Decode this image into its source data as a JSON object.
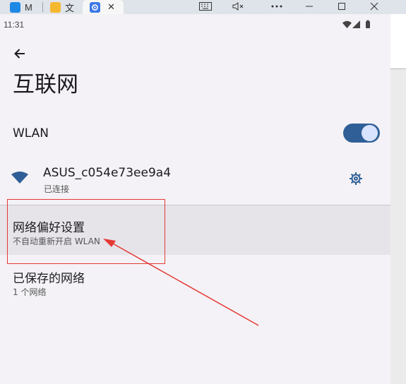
{
  "browser": {
    "tabs": [
      {
        "label": "M",
        "color": "#1e88e5"
      },
      {
        "label": "文",
        "color": "#f5b82e"
      },
      {
        "label": "",
        "color": "#3b78e7"
      }
    ],
    "close_glyph": "✕",
    "window_controls": [
      "keyboard-icon",
      "mute-icon",
      "more-icon",
      "minimize-icon",
      "maximize-icon",
      "close-icon"
    ]
  },
  "status_bar": {
    "time": "11:31"
  },
  "page": {
    "title": "互联网"
  },
  "wlan": {
    "label": "WLAN",
    "enabled": true
  },
  "network": {
    "ssid": "ASUS_c054e73ee9a4",
    "status": "已连接"
  },
  "preferences": {
    "label": "网络偏好设置",
    "sub": "不自动重新开启 WLAN"
  },
  "saved": {
    "label": "已保存的网络",
    "sub": "1 个网络"
  },
  "colors": {
    "accent": "#2f5f96",
    "annotation": "#e53935"
  }
}
